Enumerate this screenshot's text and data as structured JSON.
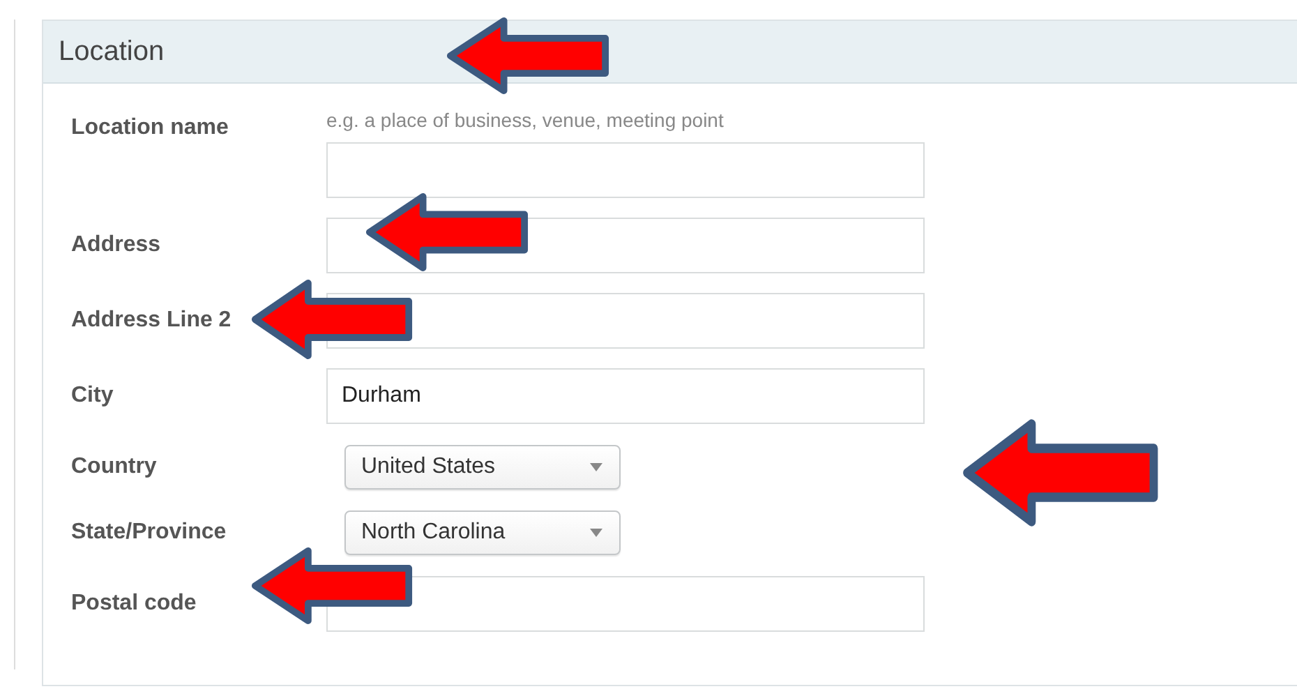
{
  "section": {
    "title": "Location"
  },
  "fields": [
    {
      "kind": "text",
      "label": "Location name",
      "hint": "e.g. a place of business, venue, meeting point"
    },
    {
      "kind": "text",
      "label": "Address"
    },
    {
      "kind": "text",
      "label": "Address Line 2"
    },
    {
      "kind": "text",
      "label": "City",
      "value": "Durham"
    },
    {
      "kind": "select",
      "label": "Country",
      "value": "United States"
    },
    {
      "kind": "select",
      "label": "State/Province",
      "value": "North Carolina"
    },
    {
      "kind": "text",
      "label": "Postal code"
    }
  ]
}
